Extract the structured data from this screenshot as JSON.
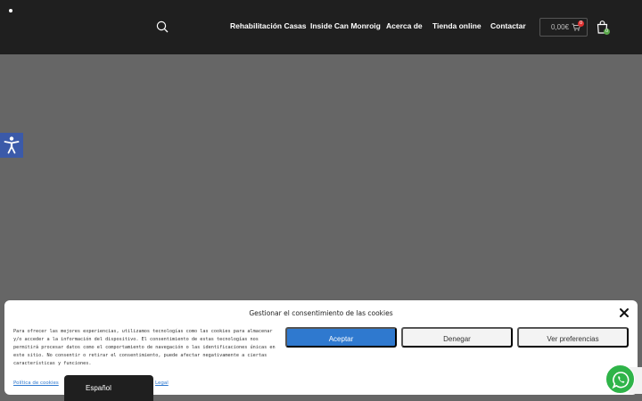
{
  "header": {
    "nav": [
      {
        "label": "Rehabilitación Casas"
      },
      {
        "label": "Inside Can Monroig"
      },
      {
        "label": "Acerca de"
      },
      {
        "label": "Tienda online"
      },
      {
        "label": "Contactar"
      }
    ],
    "cart": {
      "total": "0,00€",
      "count": "0"
    },
    "bag_count": "0"
  },
  "cookie": {
    "title": "Gestionar el consentimiento de las cookies",
    "text": "Para ofrecer las mejores experiencias, utilizamos tecnologías como las cookies para almacenar y/o acceder a la información del dispositivo. El consentimiento de estas tecnologías nos permitirá procesar datos como el comportamiento de navegación o las identificaciones únicas en este sitio. No consentir o retirar el consentimiento, puede afectar negativamente a ciertas características y funciones.",
    "accept": "Aceptar",
    "deny": "Denegar",
    "preferences": "Ver preferencias",
    "links": [
      "Política de cookies",
      "Legal"
    ]
  },
  "language": {
    "label": "Español"
  },
  "colors": {
    "accent": "#2f79cf",
    "header": "#1f1f1f",
    "whatsapp": "#2fb449",
    "accessibility": "#3b5aa9"
  }
}
